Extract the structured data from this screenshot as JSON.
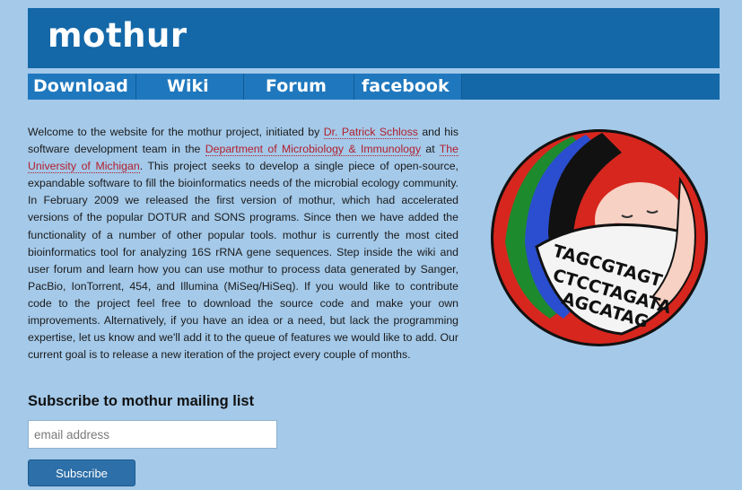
{
  "header": {
    "logo": "mothur"
  },
  "nav": {
    "items": [
      {
        "label": "Download"
      },
      {
        "label": "Wiki"
      },
      {
        "label": "Forum"
      },
      {
        "label": "facebook"
      }
    ]
  },
  "intro": {
    "t1": "Welcome to the website for the mothur project, initiated by ",
    "link1": "Dr. Patrick Schloss",
    "t2": " and his software development team in the ",
    "link2": "Department of Microbiology & Immunology",
    "t3": " at ",
    "link3": "The University of Michigan",
    "t4": ". This project seeks to develop a single piece of open-source, expandable software to fill the bioinformatics needs of the microbial ecology community. In February 2009 we released the first version of mothur, which had accelerated versions of the popular DOTUR and SONS programs. Since then we have added the functionality of a number of other popular tools. mothur is currently the most cited bioinformatics tool for analyzing 16S rRNA gene sequences. Step inside the wiki and user forum and learn how you can use mothur to process data generated by Sanger, PacBio, IonTorrent, 454, and Illumina (MiSeq/HiSeq). If you would like to contribute code to the project feel free to download the source code and make your own improvements. Alternatively, if you have an idea or a need, but lack the programming expertise, let us know and we'll add it to the queue of features we would like to add. Our current goal is to release a new iteration of the project every couple of months."
  },
  "subscribe": {
    "title": "Subscribe to mothur mailing list",
    "placeholder": "email address",
    "button": "Subscribe"
  },
  "mascot": {
    "seq1": "TAGCGTAGT",
    "seq2": "CTCCTAGATA",
    "seq3": "AGCATAG"
  }
}
